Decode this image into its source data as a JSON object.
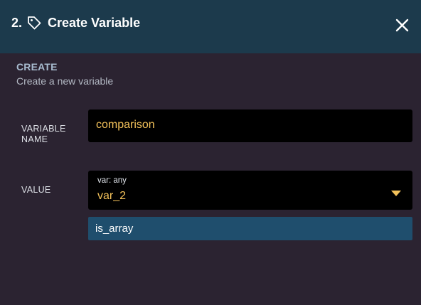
{
  "dialog": {
    "step": "2.",
    "title": "Create Variable",
    "icon": "tag-icon",
    "close_icon": "close-icon"
  },
  "section": {
    "title": "CREATE",
    "subtitle": "Create a new variable"
  },
  "fields": {
    "name_label": "VARIABLE NAME",
    "name_value": "comparison",
    "value_label": "VALUE",
    "value_caption": "var: any",
    "value_selected": "var_2",
    "value_option": "is_array"
  },
  "colors": {
    "header_bg": "#1c3a4c",
    "body_bg": "#2b2331",
    "accent": "#f2c15a",
    "option_bg": "#1f4e6d"
  }
}
